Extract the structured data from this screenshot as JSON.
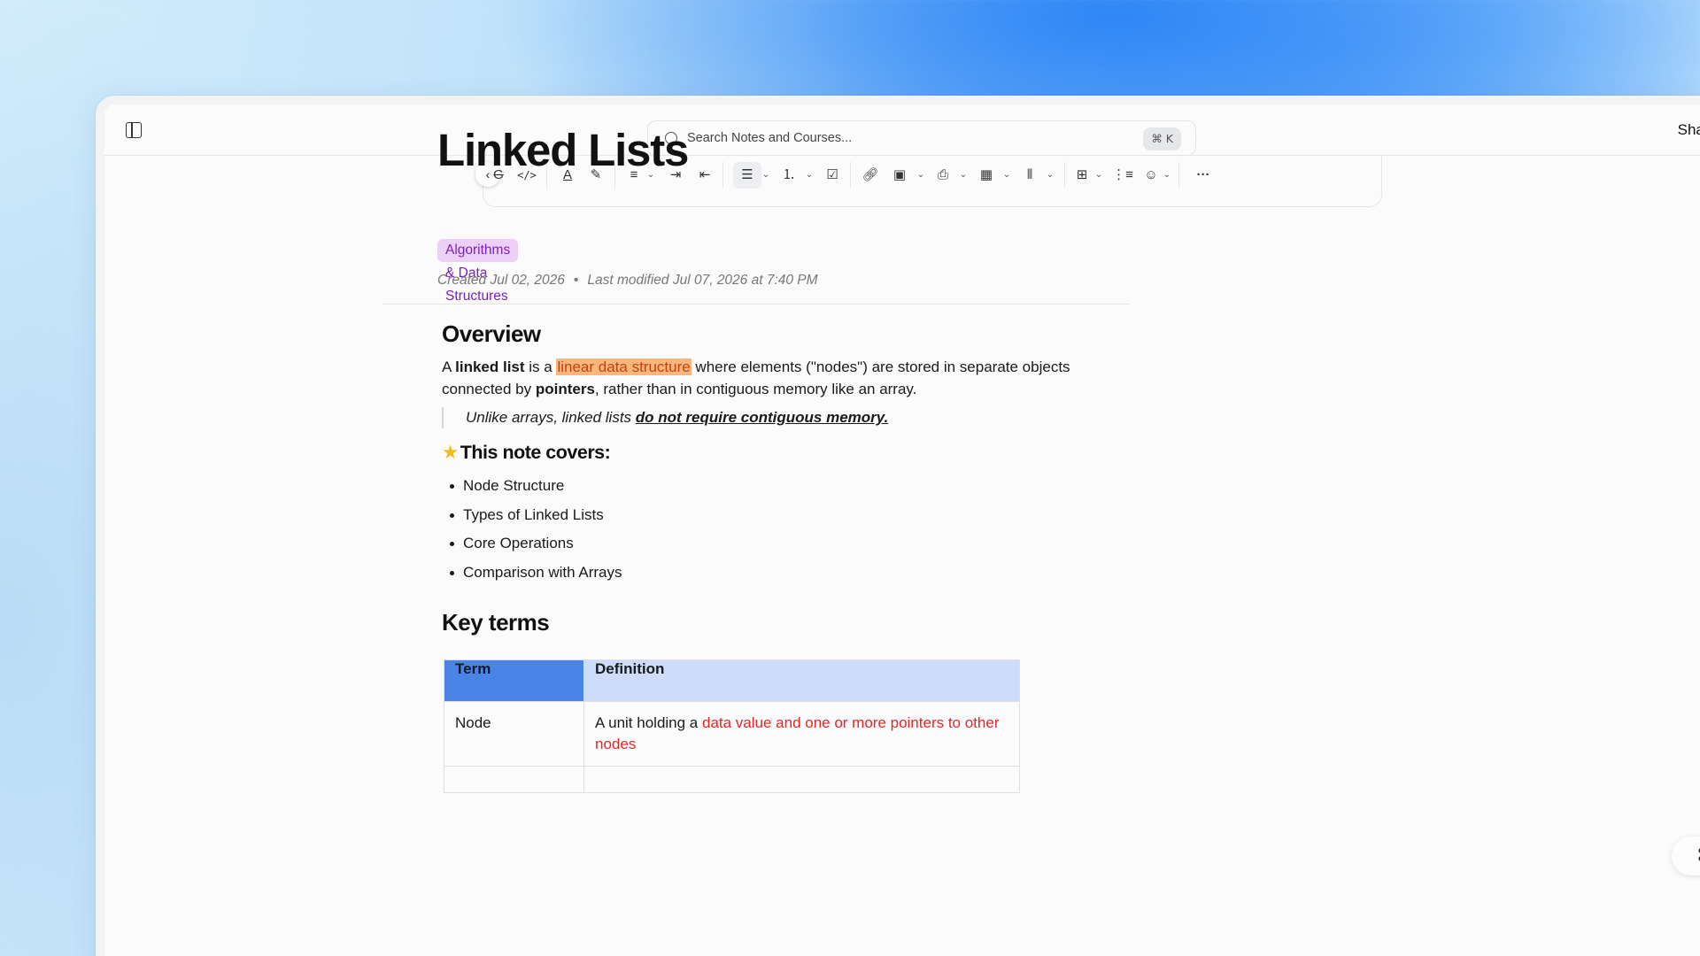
{
  "search": {
    "placeholder": "Search Notes and Courses...",
    "shortcut": "⌘ K"
  },
  "header": {
    "share_label": "Share"
  },
  "toolbar": {
    "items": [
      "strikethrough-icon",
      "code-icon",
      "text-color-icon",
      "highlighter-icon",
      "align-icon",
      "indent-icon",
      "outdent-icon",
      "bullet-list-icon",
      "numbered-list-icon",
      "checklist-icon",
      "link-icon",
      "image-icon",
      "file-icon",
      "video-icon",
      "audio-icon",
      "table-icon",
      "line-numbers-icon",
      "emoji-icon",
      "more-icon"
    ]
  },
  "note": {
    "title": "Linked Lists",
    "tag": "Algorithms & Data Structures",
    "created": "Created Jul 02, 2026",
    "modified": "Last modified Jul 07, 2026 at 7:40 PM",
    "overview_heading": "Overview",
    "overview": {
      "p1": "A ",
      "b1": "linked list",
      "p2": " is a ",
      "hl": "linear data structure",
      "p3": " where elements (\"nodes\") are stored in separate objects connected by ",
      "b2": "pointers",
      "p4": ", rather than in contiguous memory like an array."
    },
    "quote": {
      "text": "Unlike arrays, linked lists ",
      "emph": "do not require contiguous memory."
    },
    "covers_heading": "This note covers:",
    "covers": [
      "Node Structure",
      "Types of Linked Lists",
      "Core Operations",
      "Comparison with Arrays"
    ],
    "key_terms_heading": "Key terms",
    "table": {
      "headers": [
        "Term",
        "Definition"
      ],
      "rows": [
        {
          "term": "Node",
          "def_prefix": "A unit holding a ",
          "def_red": "data value and one or more pointers to other nodes"
        }
      ]
    }
  },
  "colors": {
    "accent": "#4a84e6",
    "tag_bg": "#ecd0f7",
    "tag_text": "#7b1fbf",
    "highlight": "#fdb57e",
    "red_text": "#e22828"
  }
}
